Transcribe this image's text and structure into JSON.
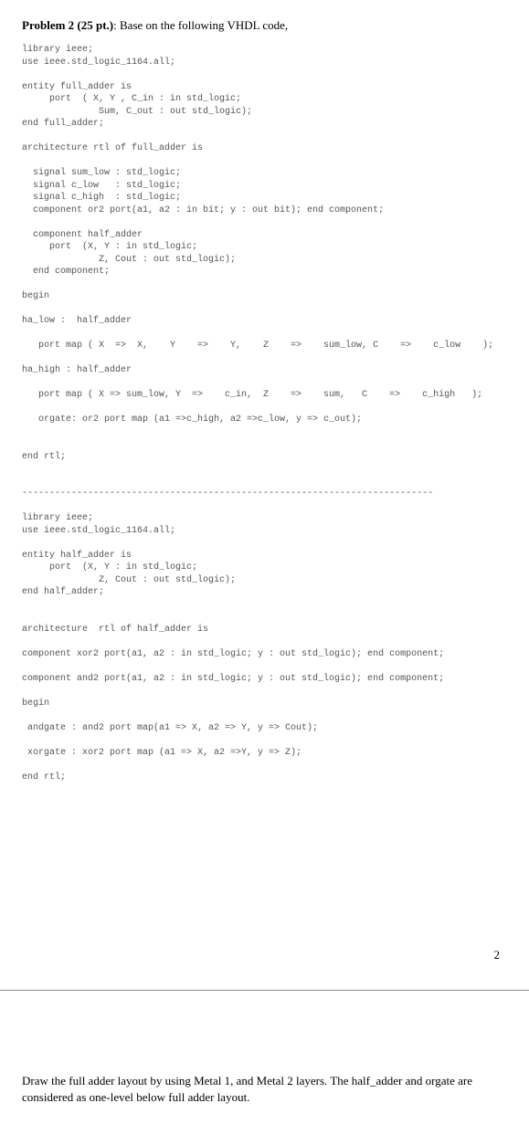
{
  "problem": {
    "label": "Problem 2 (25 pt.)",
    "sep": ":  ",
    "intro": "Base on the following VHDL code,"
  },
  "code": "library ieee;\nuse ieee.std_logic_1164.all;\n\nentity full_adder is\n     port  ( X, Y , C_in : in std_logic;\n              Sum, C_out : out std_logic);\nend full_adder;\n\narchitecture rtl of full_adder is\n\n  signal sum_low : std_logic;\n  signal c_low   : std_logic;\n  signal c_high  : std_logic;\n  component or2 port(a1, a2 : in bit; y : out bit); end component;\n\n  component half_adder\n     port  (X, Y : in std_logic;\n              Z, Cout : out std_logic);\n  end component;\n\nbegin\n\nha_low :  half_adder\n\n   port map ( X  =>  X,    Y    =>    Y,    Z    =>    sum_low, C    =>    c_low    );\n\nha_high : half_adder\n\n   port map ( X => sum_low, Y  =>    c_in,  Z    =>    sum,   C    =>    c_high   );\n\n   orgate: or2 port map (a1 =>c_high, a2 =>c_low, y => c_out);\n\n\nend rtl;\n\n\n---------------------------------------------------------------------------\n\nlibrary ieee;\nuse ieee.std_logic_1164.all;\n\nentity half_adder is\n     port  (X, Y : in std_logic;\n              Z, Cout : out std_logic);\nend half_adder;\n\n\narchitecture  rtl of half_adder is\n\ncomponent xor2 port(a1, a2 : in std_logic; y : out std_logic); end component;\n\ncomponent and2 port(a1, a2 : in std_logic; y : out std_logic); end component;\n\nbegin\n\n andgate : and2 port map(a1 => X, a2 => Y, y => Cout);\n\n xorgate : xor2 port map (a1 => X, a2 =>Y, y => Z);\n\nend rtl;",
  "page_number": "2",
  "instruction": "Draw the full adder layout by using Metal 1, and Metal 2 layers.  The half_adder and orgate are considered as one-level below full adder layout."
}
